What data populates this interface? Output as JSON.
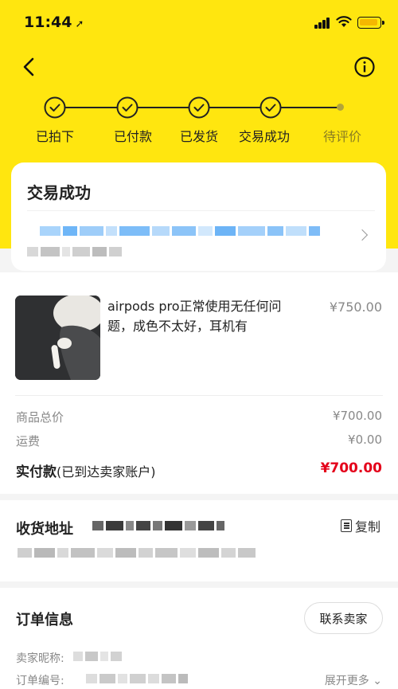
{
  "status_bar": {
    "time": "11:44",
    "location_icon": "location-arrow-icon"
  },
  "nav": {
    "back_icon": "chevron-left-icon",
    "info_icon": "info-circle-icon"
  },
  "progress": {
    "steps": [
      {
        "label": "已拍下",
        "done": true
      },
      {
        "label": "已付款",
        "done": true
      },
      {
        "label": "已发货",
        "done": true
      },
      {
        "label": "交易成功",
        "done": true
      },
      {
        "label": "待评价",
        "done": false
      }
    ]
  },
  "status_card": {
    "title": "交易成功"
  },
  "product": {
    "title": "airpods pro正常使用无任何问题，成色不太好，耳机有",
    "price": "¥750.00"
  },
  "costs": {
    "total_label": "商品总价",
    "total_value": "¥700.00",
    "shipping_label": "运费",
    "shipping_value": "¥0.00",
    "paid_label": "实付款",
    "paid_note": "(已到达卖家账户)",
    "paid_value": "¥700.00"
  },
  "address": {
    "title": "收货地址",
    "copy_label": "复制"
  },
  "order": {
    "title": "订单信息",
    "contact_label": "联系卖家",
    "seller_label": "卖家昵称:",
    "order_no_label": "订单编号:",
    "expand_label": "展开更多"
  },
  "colors": {
    "brand_yellow": "#ffe60f",
    "price_red": "#e4001a"
  }
}
